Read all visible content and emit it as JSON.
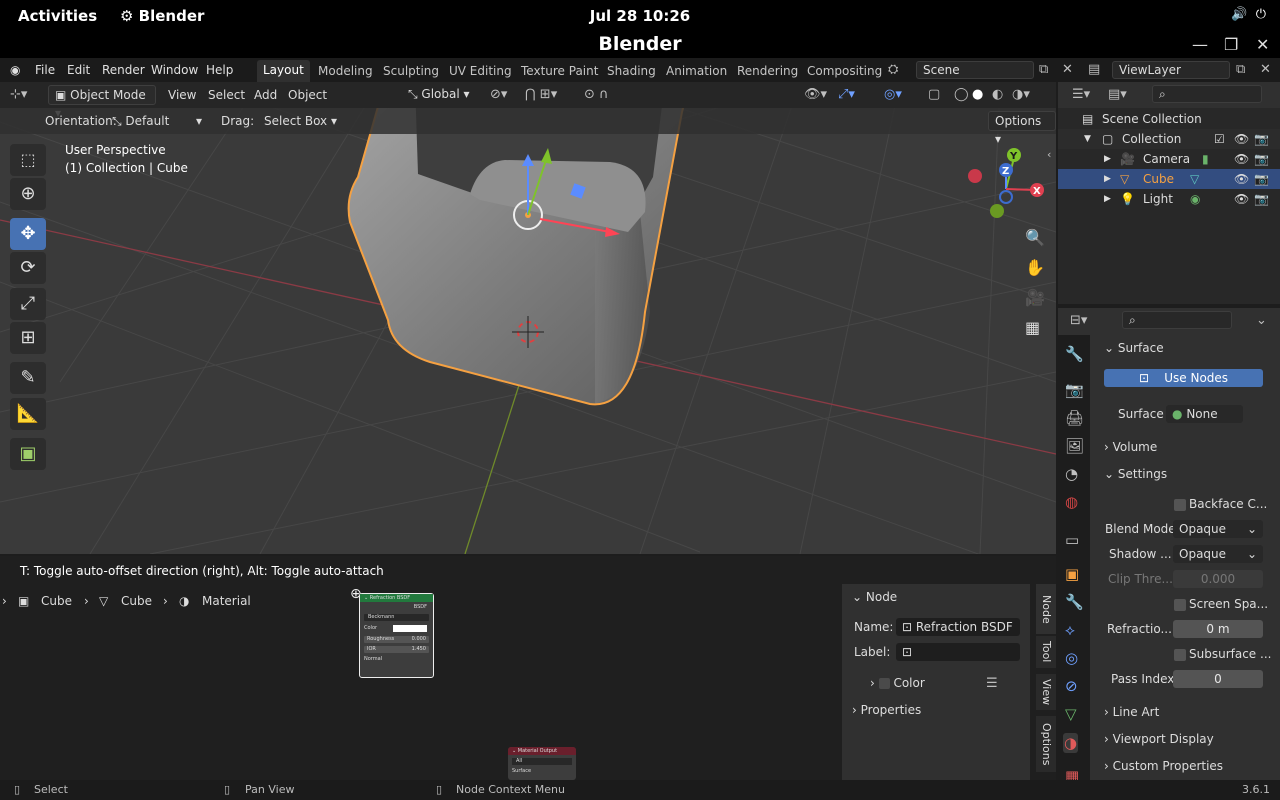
{
  "gnome": {
    "activities": "Activities",
    "app": "Blender",
    "clock": "Jul 28  10:26"
  },
  "window": {
    "title": "Blender"
  },
  "menu": {
    "items": [
      "File",
      "Edit",
      "Render",
      "Window",
      "Help"
    ],
    "workspaces": [
      "Layout",
      "Modeling",
      "Sculpting",
      "UV Editing",
      "Texture Paint",
      "Shading",
      "Animation",
      "Rendering",
      "Compositing"
    ],
    "scene": "Scene",
    "view_layer": "ViewLayer"
  },
  "viewport": {
    "mode": "Object Mode",
    "menus": [
      "View",
      "Select",
      "Add",
      "Object"
    ],
    "transform": "Global",
    "options": "Options",
    "orientation_label": "Orientation:",
    "orientation": "Default",
    "drag_label": "Drag:",
    "drag": "Select Box",
    "info_line1": "User Perspective",
    "info_line2": "(1) Collection | Cube",
    "gizmo_axes": [
      "Y",
      "Z",
      "X"
    ]
  },
  "outliner": {
    "rows": [
      {
        "label": "Scene Collection"
      },
      {
        "label": "Collection"
      },
      {
        "label": "Camera"
      },
      {
        "label": "Cube"
      },
      {
        "label": "Light"
      }
    ]
  },
  "properties": {
    "surface_header": "Surface",
    "use_nodes": "Use Nodes",
    "surface_label": "Surface",
    "surface_value": "None",
    "volume": "Volume",
    "settings": "Settings",
    "backface": "Backface C...",
    "blend_label": "Blend Mode",
    "blend_value": "Opaque",
    "shadow_label": "Shadow ...",
    "shadow_value": "Opaque",
    "clip_label": "Clip Thre...",
    "clip_value": "0.000",
    "screen_space": "Screen Spa...",
    "refraction_label": "Refractio...",
    "refraction_value": "0 m",
    "subsurface": "Subsurface ...",
    "pass_label": "Pass Index",
    "pass_value": "0",
    "line_art": "Line Art",
    "viewport_display": "Viewport Display",
    "custom_props": "Custom Properties"
  },
  "node_editor": {
    "hint": "T: Toggle auto-offset direction (right), Alt: Toggle auto-attach",
    "breadcrumb": [
      "Cube",
      "Cube",
      "Material"
    ],
    "node": {
      "title": "Refraction BSDF",
      "output": "BSDF",
      "distribution": "Beckmann",
      "color": "Color",
      "roughness": "Roughness",
      "roughness_val": "0.000",
      "ior": "IOR",
      "ior_val": "1.450",
      "normal": "Normal"
    },
    "output_node": {
      "title": "Material Output",
      "target": "All",
      "surface": "Surface"
    },
    "side": {
      "node_header": "Node",
      "name_label": "Name:",
      "name_value": "Refraction BSDF",
      "label_label": "Label:",
      "color": "Color",
      "properties": "Properties"
    },
    "tabs": [
      "Node",
      "Tool",
      "View",
      "Options"
    ]
  },
  "status": {
    "select": "Select",
    "pan": "Pan View",
    "context": "Node Context Menu",
    "version": "3.6.1"
  },
  "colors": {
    "accent": "#4772b3",
    "selection": "#f5a142",
    "header": "#303030",
    "background": "#1d1d1d"
  }
}
